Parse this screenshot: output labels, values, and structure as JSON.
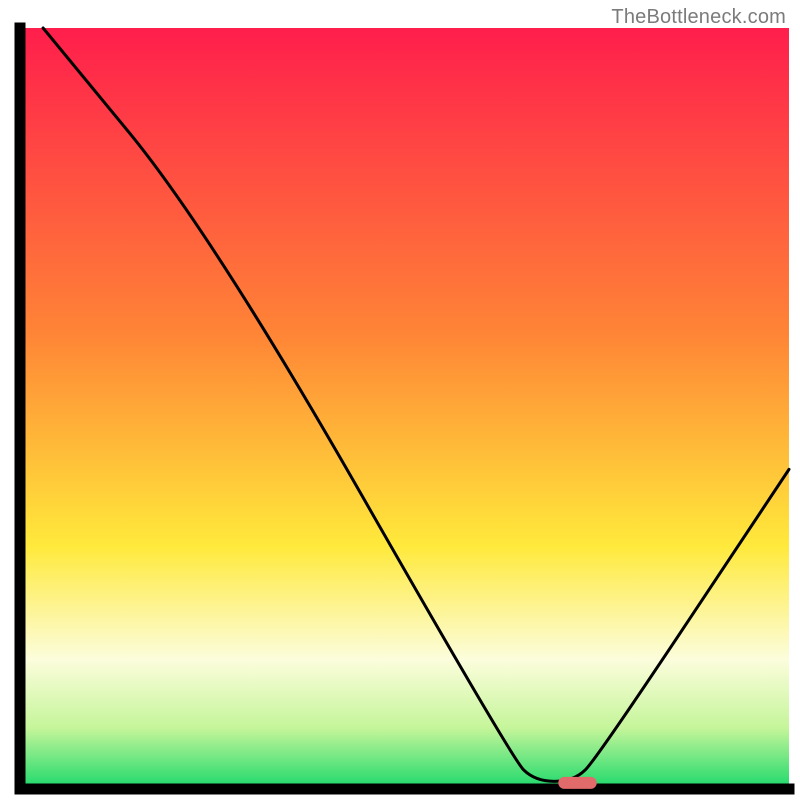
{
  "watermark": "TheBottleneck.com",
  "chart_data": {
    "type": "line",
    "title": "",
    "xlabel": "",
    "ylabel": "",
    "xlim": [
      0,
      100
    ],
    "ylim": [
      0,
      100
    ],
    "background_gradient_stops": [
      {
        "offset": 0,
        "color": "#ff1e4c"
      },
      {
        "offset": 40,
        "color": "#ff8436"
      },
      {
        "offset": 68,
        "color": "#ffe93b"
      },
      {
        "offset": 83,
        "color": "#fcfddc"
      },
      {
        "offset": 92,
        "color": "#c5f59a"
      },
      {
        "offset": 100,
        "color": "#1bd96b"
      }
    ],
    "curve_points": [
      {
        "x": 3,
        "y": 100
      },
      {
        "x": 25,
        "y": 73
      },
      {
        "x": 64,
        "y": 4
      },
      {
        "x": 67,
        "y": 1
      },
      {
        "x": 72,
        "y": 1
      },
      {
        "x": 75,
        "y": 4
      },
      {
        "x": 100,
        "y": 42
      }
    ],
    "marker": {
      "x_start": 70,
      "x_end": 75,
      "y": 0.8,
      "color": "#e16a6a"
    },
    "axis_color": "#000000",
    "curve_color": "#000000"
  }
}
